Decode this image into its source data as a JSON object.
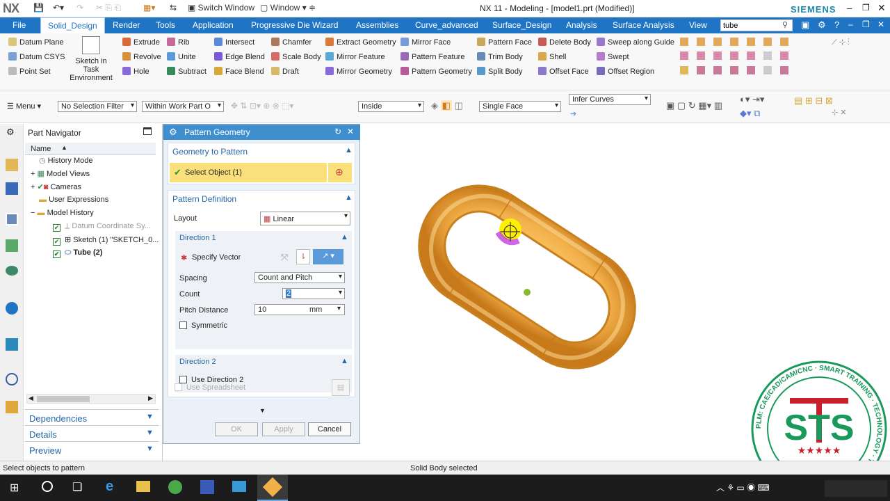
{
  "window": {
    "app": "NX",
    "title": "NX 11 - Modeling - [model1.prt (Modified)]",
    "brand": "SIEMENS",
    "switch_window": "Switch Window",
    "window_menu": "Window"
  },
  "tabs": [
    "File",
    "Solid_Design",
    "Render",
    "Tools",
    "Application",
    "Progressive Die Wizard",
    "Assemblies",
    "Curve_advanced",
    "Surface_Design",
    "Analysis",
    "Surface Analysis",
    "View"
  ],
  "search": {
    "value": "tube"
  },
  "ribbon": {
    "col1": [
      "Datum Plane",
      "Datum CSYS",
      "Point Set"
    ],
    "sketch": "Sketch in Task Environment",
    "col2": [
      "Extrude",
      "Revolve",
      "Hole"
    ],
    "col3": [
      "Rib",
      "Unite",
      "Subtract"
    ],
    "col4": [
      "Intersect",
      "Edge Blend",
      "Face Blend"
    ],
    "col5": [
      "Chamfer",
      "Scale Body",
      "Draft"
    ],
    "col6": [
      "Extract Geometry",
      "Mirror Feature",
      "Mirror Geometry"
    ],
    "col7": [
      "Mirror Face",
      "Pattern Feature",
      "Pattern Geometry"
    ],
    "col8": [
      "Pattern Face",
      "Trim Body",
      "Split Body"
    ],
    "col9": [
      "Delete Body",
      "Shell",
      "Offset Face"
    ],
    "col10": [
      "Sweep along Guide",
      "Swept",
      "Offset Region"
    ]
  },
  "selbar": {
    "menu": "Menu",
    "filter": "No Selection Filter",
    "scope": "Within Work Part O",
    "inside": "Inside",
    "face": "Single Face",
    "curves": "Infer Curves"
  },
  "navigator": {
    "title": "Part Navigator",
    "col_name": "Name",
    "items": [
      "History Mode",
      "Model Views",
      "Cameras",
      "User Expressions",
      "Model History",
      "Datum Coordinate Sy...",
      "Sketch (1) \"SKETCH_0...",
      "Tube (2)"
    ],
    "panels": [
      "Dependencies",
      "Details",
      "Preview"
    ]
  },
  "dialog": {
    "title": "Pattern Geometry",
    "geom_section": "Geometry to Pattern",
    "select_object": "Select Object (1)",
    "pattern_def": "Pattern Definition",
    "layout_label": "Layout",
    "layout_value": "Linear",
    "direction1": "Direction 1",
    "specify_vector": "Specify Vector",
    "spacing_label": "Spacing",
    "spacing_value": "Count and Pitch",
    "count_label": "Count",
    "count_value": "2",
    "pitch_label": "Pitch Distance",
    "pitch_value": "10",
    "pitch_unit": "mm",
    "symmetric": "Symmetric",
    "direction2": "Direction 2",
    "use_direction2": "Use Direction 2",
    "use_spreadsheet": "Use Spreadsheet",
    "ok": "OK",
    "apply": "Apply",
    "cancel": "Cancel"
  },
  "status": {
    "left": "Select objects to pattern",
    "center": "Solid Body selected"
  },
  "logo": {
    "ring_text": "PLM: CAE/CAD/CAM/CNC · SMART TRAINING · TECHNOLOGY · TRANSFORMATION SOLUTIONS",
    "letters": "STS"
  },
  "colors": {
    "accent": "#1f75c4",
    "dialog_header": "#3f8fcf",
    "selected": "#f9e07a",
    "tube": "#f2b04a",
    "logo": "#1a9a5a",
    "logo_red": "#c8202a"
  }
}
